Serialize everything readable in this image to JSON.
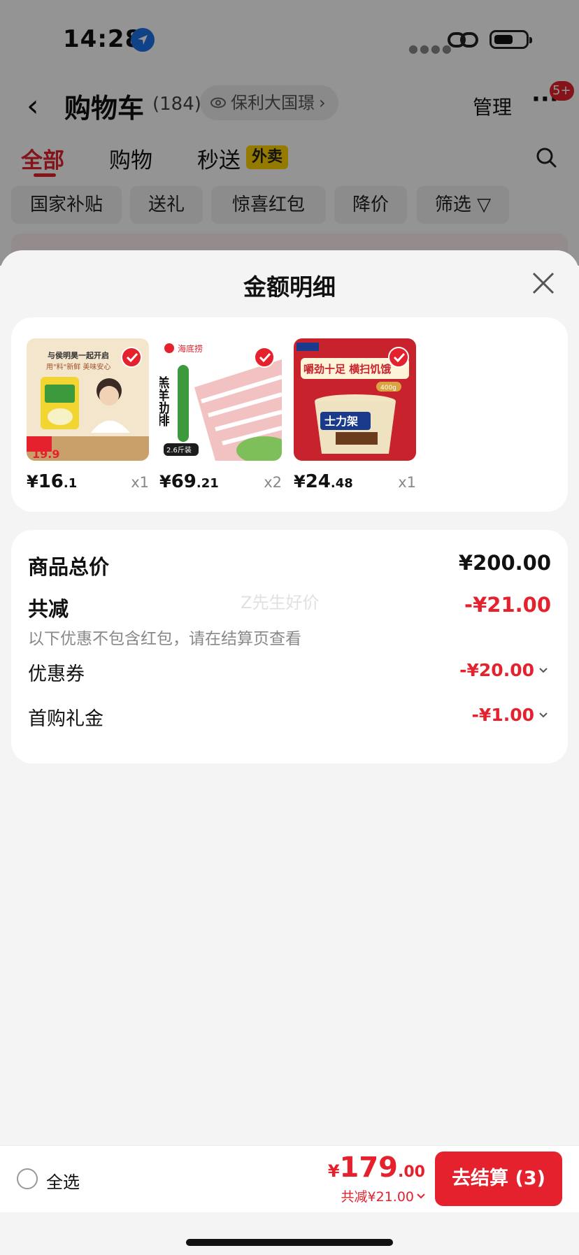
{
  "status_bar": {
    "time": "14:28"
  },
  "header": {
    "title": "购物车",
    "count": "(184)",
    "store": "保利大国璟",
    "manage": "管理",
    "message_badge": "5+"
  },
  "tabs": [
    {
      "label": "全部"
    },
    {
      "label": "购物"
    },
    {
      "label": "秒送"
    }
  ],
  "tab_badge": "外卖",
  "chips": [
    "国家补贴",
    "送礼",
    "惊喜红包",
    "降价",
    "筛选"
  ],
  "sheet": {
    "title": "金额明细",
    "products": [
      {
        "price_int": "16",
        "price_dec": ".1",
        "qty": "x1"
      },
      {
        "price_int": "69",
        "price_dec": ".21",
        "qty": "x2"
      },
      {
        "price_int": "24",
        "price_dec": ".48",
        "qty": "x1"
      }
    ],
    "product_image_text": {
      "p1_line1": "与侯明昊一起开启",
      "p1_line2": "用\"料\"新鲜 美味安心",
      "p1_price": "19.9",
      "p2_brand": "海底捞",
      "p2_name": "羔羊肋排",
      "p2_weight": "2.6斤装",
      "p3_slogan": "嚼劲十足 横扫饥饿",
      "p3_brand": "士力架",
      "p3_weight": "400g"
    },
    "summary": {
      "total_label": "商品总价",
      "total_value": "¥200.00",
      "discount_label": "共减",
      "discount_value": "-¥21.00",
      "discount_note": "以下优惠不包含红包，请在结算页查看",
      "coupon_label": "优惠券",
      "coupon_value": "-¥20.00",
      "gift_label": "首购礼金",
      "gift_value": "-¥1.00",
      "watermark": "Z先生好价"
    }
  },
  "bottom_bar": {
    "select_all": "全选",
    "currency": "¥",
    "total_int": "179",
    "total_dec": ".00",
    "total_discount": "共减¥21.00",
    "checkout": "去结算 (3)"
  },
  "colors": {
    "accent": "#e5212d",
    "badge_yellow": "#ffd400"
  }
}
